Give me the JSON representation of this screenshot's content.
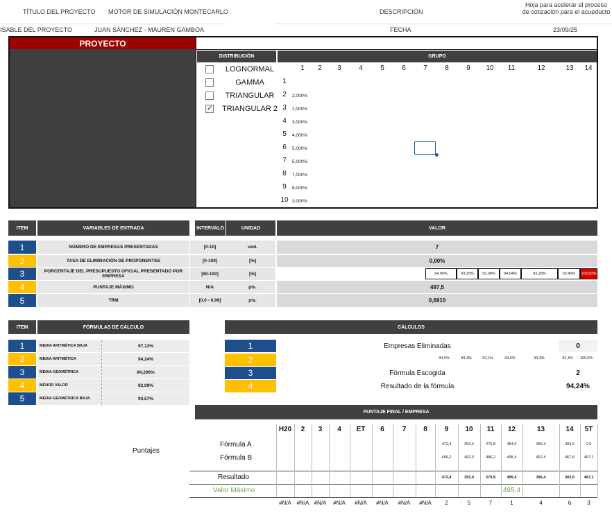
{
  "header": {
    "title_label": "TÍTULO DEL PROYECTO",
    "title_value": "MOTOR DE SIMULACIÓN MONTECARLO",
    "desc_label": "DESCRIPCIÓN",
    "desc_value": "Hoja para acelerar el proceso de cotización para el acueducto",
    "resp_label": "ISABLE DEL PROYECTO",
    "resp_value": "JUAN SÁNCHEZ - MAUREN GAMBOA",
    "date_label": "FECHA",
    "date_value": "23/09/25"
  },
  "proyecto": {
    "title": "PROYECTO",
    "distribucion_label": "DISTRIBUCIÓN",
    "grupo_label": "GRUPO",
    "distributions": [
      {
        "label": "LOGNORMAL",
        "checked": false
      },
      {
        "label": "GAMMA",
        "checked": false
      },
      {
        "label": "TRIANGULAR",
        "checked": false
      },
      {
        "label": "TRIANGULAR 2",
        "checked": true
      }
    ],
    "group_cols": [
      "1",
      "2",
      "3",
      "4",
      "5",
      "6",
      "7",
      "8",
      "9",
      "10",
      "11",
      "12",
      "13",
      "14"
    ],
    "group_rows": [
      "1",
      "2",
      "3",
      "4",
      "5",
      "6",
      "7",
      "8",
      "9",
      "10"
    ],
    "row_values": [
      "",
      "2,000%",
      "2,000%",
      "3,000%",
      "4,000%",
      "5,000%",
      "5,000%",
      "7,000%",
      "8,000%",
      "3,000%"
    ]
  },
  "inputs": {
    "headers": {
      "item": "ITEM",
      "variables": "VARIABLES DE ENTRADA",
      "intervalo": "INTERVALO",
      "unidad": "UNIDAD",
      "valor": "VALOR"
    },
    "rows": [
      {
        "num": "1",
        "label": "NÚMERO DE EMPRESAS PRESENTADAS",
        "intervalo": "[0-10]",
        "unidad": "und.",
        "valor": "7"
      },
      {
        "num": "2",
        "label": "TASA DE ELIMINACIÓN DE PROPONENTES",
        "intervalo": "[0-100]",
        "unidad": "[%]",
        "valor": "0,00%"
      },
      {
        "num": "3",
        "label": "PORCENTAJE DEL PRESUPUESTO OFICIAL PRESENTADO POR EMPRESA",
        "intervalo": "[90-100]",
        "unidad": "[%]",
        "valor": ""
      },
      {
        "num": "4",
        "label": "PUNTAJE MÁXIMO",
        "intervalo": "N/A",
        "unidad": "pts.",
        "valor": "497,5"
      },
      {
        "num": "5",
        "label": "TRM",
        "intervalo": "[0,0 - 0,99]",
        "unidad": "pts.",
        "valor": "0,6910"
      }
    ],
    "pct_values": [
      "94,00%",
      "93,25%",
      "92,09%",
      "94,64%",
      "93,28%",
      "92,40%",
      "100,00%"
    ]
  },
  "formulas": {
    "headers": {
      "item": "ITEM",
      "formulas": "FÓRMULAS DE CÁLCULO"
    },
    "rows": [
      {
        "num": "1",
        "label": "MEDIA ARITMÉTICA BAJA",
        "value": "97,12%"
      },
      {
        "num": "2",
        "label": "MEDIA ARITMÉTICA",
        "value": "94,24%"
      },
      {
        "num": "3",
        "label": "MEDIA GEOMÉTRICA",
        "value": "94,206%"
      },
      {
        "num": "4",
        "label": "MENOR VALOR",
        "value": "92,09%"
      },
      {
        "num": "5",
        "label": "MEDIA GEOMÉTRICA BAJA",
        "value": "93,57%"
      }
    ]
  },
  "calculos": {
    "title": "CÁLCULOS",
    "rows": [
      {
        "num": "1",
        "label": "Empresas Eliminadas",
        "value": "0"
      },
      {
        "num": "2",
        "label": "",
        "value": ""
      },
      {
        "num": "3",
        "label": "Fórmula Escogida",
        "value": "2"
      },
      {
        "num": "4",
        "label": "Resultado de la fórmula",
        "value": "94,24%"
      }
    ],
    "row2_values": [
      "94,0%",
      "93,3%",
      "92,1%",
      "94,6%",
      "93,3%",
      "92,4%",
      "100,0%"
    ]
  },
  "puntaje": {
    "title": "PUNTAJE FINAL / EMPRESA",
    "side_label": "Puntajes",
    "cols": [
      "H20",
      "2",
      "3",
      "4",
      "ET",
      "6",
      "7",
      "8",
      "9",
      "10",
      "11",
      "12",
      "13",
      "14",
      "5T"
    ],
    "formula_a_label": "Fórmula A",
    "formula_b_label": "Fórmula B",
    "formula_a": [
      "",
      "",
      "",
      "",
      "",
      "",
      "",
      "",
      "472,4",
      "393,4",
      "270,8",
      "454,9",
      "396,4",
      "303,5",
      "0,0"
    ],
    "formula_b": [
      "",
      "",
      "",
      "",
      "",
      "",
      "",
      "",
      "496,2",
      "492,3",
      "486,2",
      "495,4",
      "492,4",
      "467,8",
      "467,1"
    ],
    "resultado_label": "Resultado",
    "resultado": [
      "",
      "",
      "",
      "",
      "",
      "",
      "",
      "",
      "472,4",
      "393,4",
      "270,8",
      "495,4",
      "396,4",
      "303,5",
      "467,1"
    ],
    "valor_max_label": "Valor Máximo",
    "valor_max": "495,4",
    "ranks": [
      "#N/A",
      "#N/A",
      "#N/A",
      "#N/A",
      "#N/A",
      "#N/A",
      "#N/A",
      "#N/A",
      "2",
      "5",
      "7",
      "1",
      "4",
      "6",
      "3"
    ]
  }
}
